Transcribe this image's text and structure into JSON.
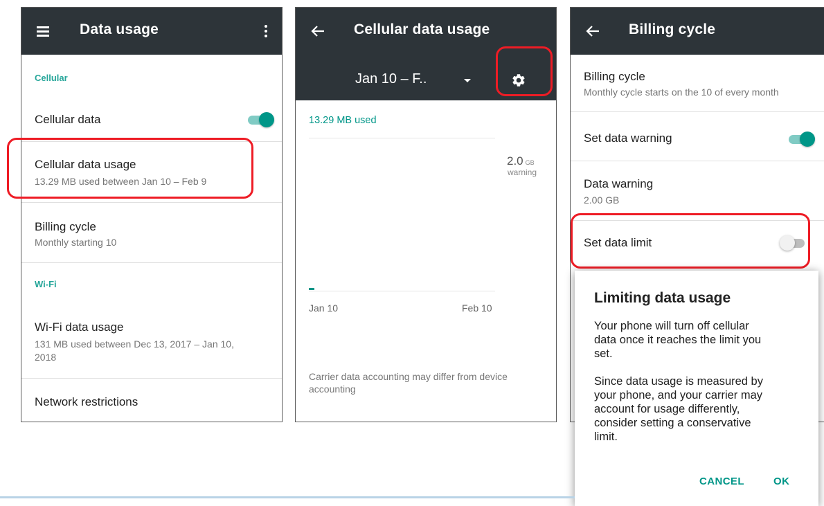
{
  "screen1": {
    "title": "Data usage",
    "icons": {
      "menu": "hamburger-menu-icon",
      "overflow": "more-vert-icon"
    },
    "category_cellular": "Cellular",
    "cellular_data": {
      "label": "Cellular data",
      "toggle": "on"
    },
    "cellular_data_usage": {
      "title": "Cellular data usage",
      "subtitle": "13.29 MB used between Jan 10 – Feb 9"
    },
    "billing_cycle": {
      "title": "Billing cycle",
      "subtitle": "Monthly starting 10"
    },
    "category_wifi": "Wi-Fi",
    "wifi_data_usage": {
      "title": "Wi-Fi data usage",
      "subtitle_line1": "131 MB used between Dec 13, 2017 – Jan 10,",
      "subtitle_line2": "2018"
    },
    "network_restrictions": "Network restrictions"
  },
  "screen2": {
    "title": "Cellular data usage",
    "date_range": "Jan 10 – F..",
    "icons": {
      "back": "arrow-back-icon",
      "dropdown": "dropdown-arrow-icon",
      "settings": "gear-icon"
    },
    "usage_label": "13.29 MB used",
    "warning_value": "2.0",
    "warning_unit": "GB",
    "warning_label": "warning",
    "x_start": "Jan 10",
    "x_end": "Feb 10",
    "footer_line1": "Carrier data accounting may differ from device",
    "footer_line2": "accounting"
  },
  "screen3": {
    "title": "Billing cycle",
    "icons": {
      "back": "arrow-back-icon"
    },
    "billing_cycle": {
      "title": "Billing cycle",
      "subtitle": "Monthly cycle starts on the 10 of every month"
    },
    "set_data_warning": {
      "label": "Set data warning",
      "toggle": "on"
    },
    "data_warning": {
      "title": "Data warning",
      "subtitle": "2.00 GB"
    },
    "set_data_limit": {
      "label": "Set data limit",
      "toggle": "off"
    }
  },
  "dialog": {
    "title": "Limiting data usage",
    "body_p1": [
      "Your phone will turn off cellular",
      "data once it reaches the limit you",
      "set."
    ],
    "body_p2": [
      "Since data usage is measured by",
      "your phone, and your carrier may",
      "account for usage differently,",
      "consider setting a conservative",
      "limit."
    ],
    "cancel": "CANCEL",
    "ok": "OK"
  },
  "colors": {
    "appbar": "#2d3439",
    "accent": "#009688",
    "highlight": "#ee1c25"
  }
}
